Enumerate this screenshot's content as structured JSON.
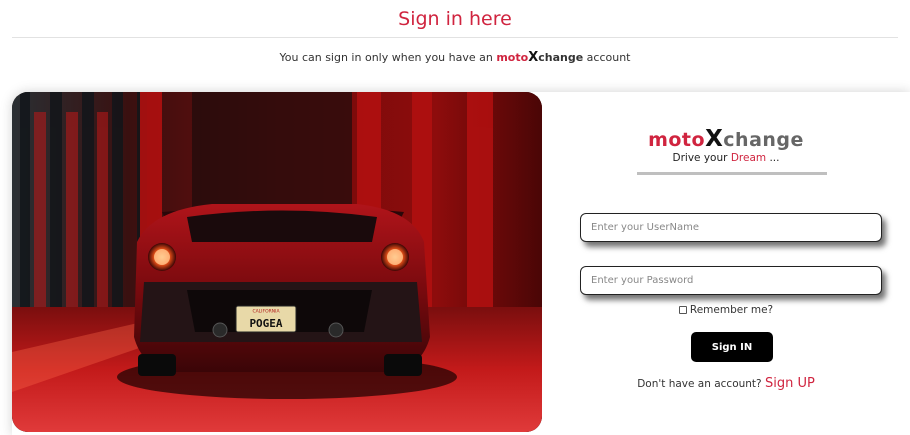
{
  "header": {
    "title": "Sign in here",
    "subtitle_prefix": "You can sign in only when you have an",
    "subtitle_brand_moto": "moto",
    "subtitle_brand_x": "X",
    "subtitle_brand_change": "change",
    "subtitle_suffix": "account"
  },
  "hero": {
    "plate_state": "CALIFORNIA",
    "plate_text": "POGEA"
  },
  "login": {
    "logo_moto": "moto",
    "logo_x": "X",
    "logo_change": "change",
    "tagline_prefix": "Drive your",
    "tagline_dream": "Dream",
    "tagline_suffix": "...",
    "username_placeholder": "Enter your UserName",
    "password_placeholder": "Enter your Password",
    "remember_label": "Remember me?",
    "signin_label": "Sign IN",
    "signup_prompt": "Don't have an account?",
    "signup_link": "Sign UP"
  },
  "colors": {
    "accent": "#d0243f",
    "button": "#000000"
  }
}
